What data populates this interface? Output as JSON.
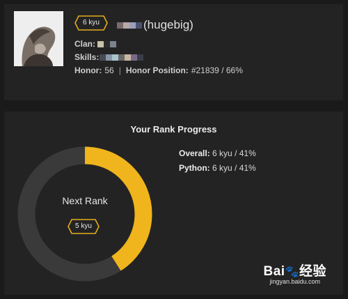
{
  "profile": {
    "rank_badge": "6 kyu",
    "username": "(hugebig)",
    "clan_label": "Clan:",
    "skills_label": "Skills:",
    "honor_label": "Honor:",
    "honor_value": "56",
    "separator": "|",
    "honor_position_label": "Honor Position:",
    "honor_position_value": "#21839 / 66%"
  },
  "rank_progress": {
    "title": "Your Rank Progress",
    "overall_label": "Overall:",
    "overall_value": "6 kyu / 41%",
    "python_label": "Python:",
    "python_value": "6 kyu / 41%",
    "next_rank_label": "Next Rank",
    "next_rank_badge": "5 kyu",
    "progress_fraction": 0.41,
    "colors": {
      "progress": "#f0b41c",
      "track": "#3a3a3b",
      "background": "#232324"
    }
  },
  "watermark": {
    "logo_left": "Bai",
    "logo_paw": "🐾",
    "logo_right": "经验",
    "url": "jingyan.baidu.com"
  }
}
